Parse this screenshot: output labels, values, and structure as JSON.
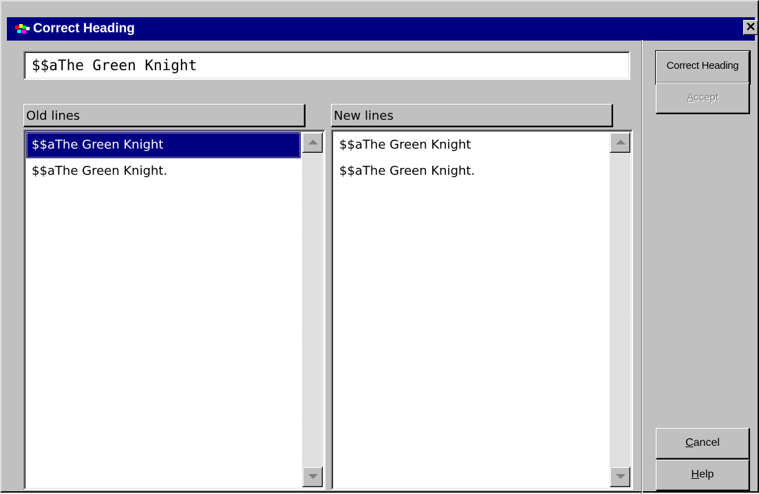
{
  "window": {
    "title": "Correct Heading",
    "close_glyph": "✕"
  },
  "heading_field": {
    "value": "$$aThe Green Knight"
  },
  "old_lines": {
    "header": "Old lines",
    "items": [
      {
        "text": "$$aThe Green Knight",
        "selected": true
      },
      {
        "text": "$$aThe Green Knight.",
        "selected": false
      }
    ]
  },
  "new_lines": {
    "header": "New lines",
    "items": [
      {
        "text": "$$aThe Green Knight"
      },
      {
        "text": "$$aThe Green Knight."
      }
    ]
  },
  "buttons": {
    "correct_heading": "Correct Heading",
    "accept_prefix": "",
    "accept_mnemonic": "A",
    "accept_rest": "ccept",
    "cancel_mnemonic": "C",
    "cancel_rest": "ancel",
    "help_mnemonic": "H",
    "help_rest": "elp"
  },
  "icons": {
    "app": "app-icon",
    "close": "close-icon",
    "scroll_up": "scroll-up-arrow-icon",
    "scroll_down": "scroll-down-arrow-icon"
  },
  "colors": {
    "titlebar": "#000080",
    "selection": "#000080",
    "face": "#c0c0c0",
    "disabled_text": "#808080"
  }
}
